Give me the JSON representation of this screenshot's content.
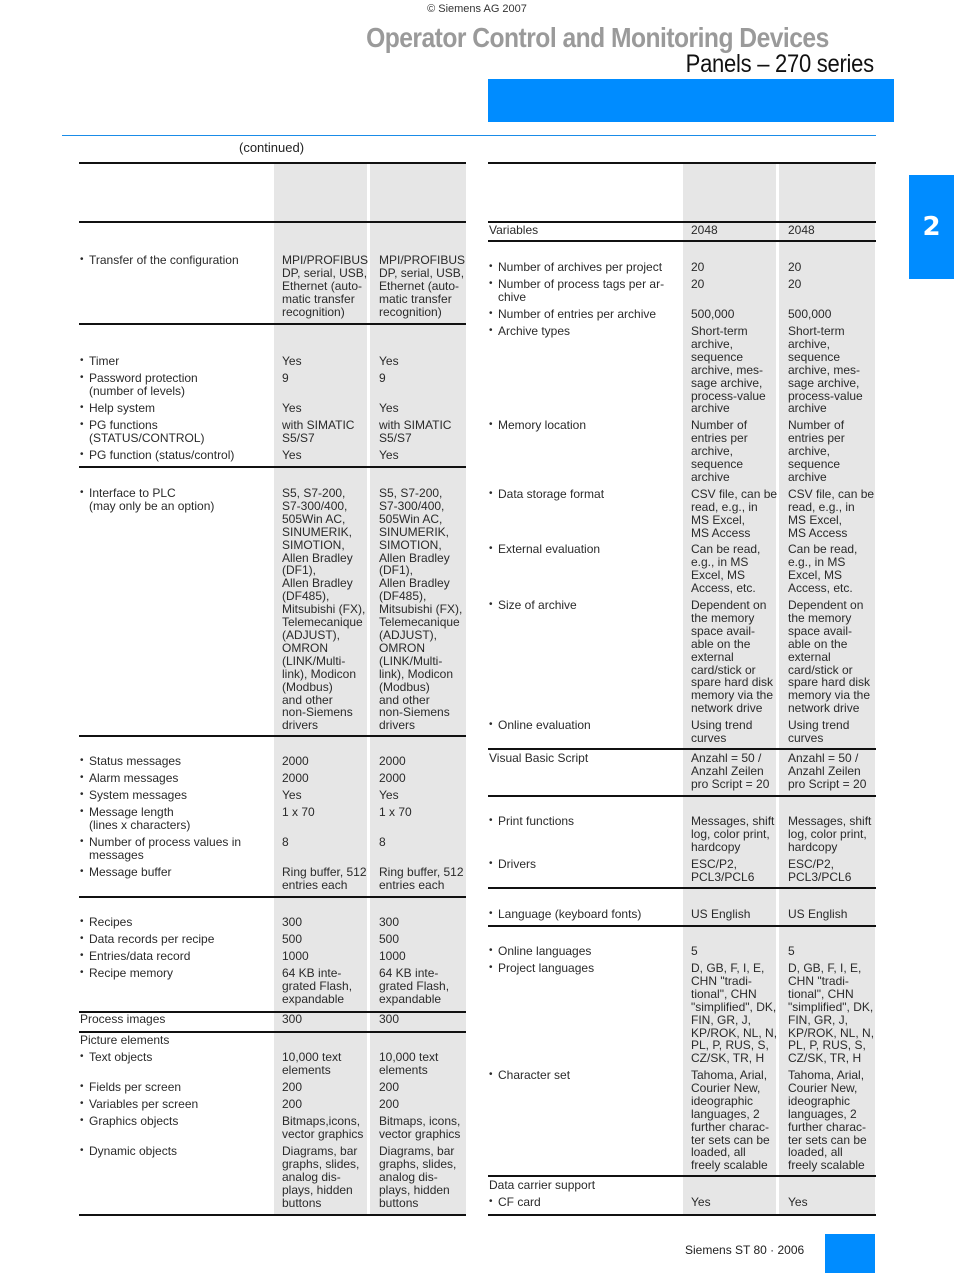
{
  "header": {
    "copyright": "© Siemens AG 2007",
    "title": "Operator Control and Monitoring Devices",
    "subtitle": "Panels – 270 series",
    "continued": "(continued)",
    "chapter_tab": "2",
    "brand_color": "#008cff"
  },
  "footer": {
    "text": "Siemens ST 80 · 2006"
  },
  "left_table": {
    "rows": [
      {
        "label": "Transfer of the configuration",
        "bullet": true,
        "values": [
          "MPI/PROFIBUS\nDP, serial, USB,\nEthernet (auto-\nmatic transfer\nrecognition)",
          "MPI/PROFIBUS\nDP, serial, USB,\nEthernet (auto-\nmatic transfer\nrecognition)"
        ]
      },
      {
        "label": "Timer",
        "bullet": true,
        "values": [
          "Yes",
          "Yes"
        ]
      },
      {
        "label": "Password protection\n(number of levels)",
        "bullet": true,
        "values": [
          "9",
          "9"
        ]
      },
      {
        "label": "Help system",
        "bullet": true,
        "values": [
          "Yes",
          "Yes"
        ]
      },
      {
        "label": "PG functions\n(STATUS/CONTROL)",
        "bullet": true,
        "values": [
          "with SIMATIC\nS5/S7",
          "with SIMATIC\nS5/S7"
        ]
      },
      {
        "label": "PG function (status/control)",
        "bullet": true,
        "values": [
          "Yes",
          "Yes"
        ]
      },
      {
        "label": "Interface to PLC\n(may only be an option)",
        "bullet": true,
        "values": [
          "S5, S7-200,\nS7-300/400,\n505Win AC,\nSINUMERIK,\nSIMOTION,\nAllen Bradley\n(DF1),\nAllen Bradley\n(DF485),\nMitsubishi (FX),\nTelemecanique\n(ADJUST),\nOMRON\n(LINK/Multi-\nlink), Modicon\n(Modbus)\nand other\nnon-Siemens\ndrivers",
          "S5, S7-200,\nS7-300/400,\n505Win AC,\nSINUMERIK,\nSIMOTION,\nAllen Bradley\n(DF1),\nAllen Bradley\n(DF485),\nMitsubishi (FX),\nTelemecanique\n(ADJUST),\nOMRON\n(LINK/Multi-\nlink), Modicon\n(Modbus)\nand other\nnon-Siemens\ndrivers"
        ]
      },
      {
        "label": "Status messages",
        "bullet": true,
        "values": [
          "2000",
          "2000"
        ]
      },
      {
        "label": "Alarm messages",
        "bullet": true,
        "values": [
          "2000",
          "2000"
        ]
      },
      {
        "label": "System messages",
        "bullet": true,
        "values": [
          "Yes",
          "Yes"
        ]
      },
      {
        "label": "Message length\n(lines x characters)",
        "bullet": true,
        "values": [
          "1 x 70",
          "1 x 70"
        ]
      },
      {
        "label": "Number of process values in\nmessages",
        "bullet": true,
        "values": [
          "8",
          "8"
        ]
      },
      {
        "label": "Message buffer",
        "bullet": true,
        "values": [
          "Ring buffer, 512\nentries each",
          "Ring buffer, 512\nentries each"
        ]
      },
      {
        "label": "Recipes",
        "bullet": true,
        "values": [
          "300",
          "300"
        ]
      },
      {
        "label": "Data records per recipe",
        "bullet": true,
        "values": [
          "500",
          "500"
        ]
      },
      {
        "label": "Entries/data record",
        "bullet": true,
        "values": [
          "1000",
          "1000"
        ]
      },
      {
        "label": "Recipe memory",
        "bullet": true,
        "values": [
          "64 KB inte-\ngrated Flash,\nexpandable",
          "64 KB inte-\ngrated Flash,\nexpandable"
        ]
      },
      {
        "label": "Process images",
        "bullet": false,
        "values": [
          "300",
          "300"
        ]
      },
      {
        "label": "Picture elements",
        "bullet": false,
        "values": [
          "",
          ""
        ]
      },
      {
        "label": "Text objects",
        "bullet": true,
        "values": [
          "10,000 text\nelements",
          "10,000 text\nelements"
        ]
      },
      {
        "label": "Fields per screen",
        "bullet": true,
        "values": [
          "200",
          "200"
        ]
      },
      {
        "label": "Variables per screen",
        "bullet": true,
        "values": [
          "200",
          "200"
        ]
      },
      {
        "label": "Graphics objects",
        "bullet": true,
        "values": [
          "Bitmaps,icons,\nvector graphics",
          "Bitmaps, icons,\nvector graphics"
        ]
      },
      {
        "label": "Dynamic objects",
        "bullet": true,
        "values": [
          "Diagrams, bar\ngraphs, slides,\nanalog dis-\nplays, hidden\nbuttons",
          "Diagrams, bar\ngraphs, slides,\nanalog dis-\nplays, hidden\nbuttons"
        ]
      }
    ]
  },
  "right_table": {
    "rows": [
      {
        "label": "Variables",
        "bullet": false,
        "values": [
          "2048",
          "2048"
        ]
      },
      {
        "label": "Number of archives per project",
        "bullet": true,
        "values": [
          "20",
          "20"
        ]
      },
      {
        "label": "Number of process tags per ar-\nchive",
        "bullet": true,
        "values": [
          "20",
          "20"
        ]
      },
      {
        "label": "Number of entries per archive",
        "bullet": true,
        "values": [
          "500,000",
          "500,000"
        ]
      },
      {
        "label": "Archive types",
        "bullet": true,
        "values": [
          "Short-term\narchive,\nsequence\narchive, mes-\nsage archive,\nprocess-value\narchive",
          "Short-term\narchive,\nsequence\narchive, mes-\nsage archive,\nprocess-value\narchive"
        ]
      },
      {
        "label": "Memory location",
        "bullet": true,
        "values": [
          "Number of\nentries per\narchive,\nsequence\narchive",
          "Number of\nentries per\narchive,\nsequence\narchive"
        ]
      },
      {
        "label": "Data storage format",
        "bullet": true,
        "values": [
          "CSV file, can be\nread, e.g., in\nMS Excel,\nMS Access",
          "CSV file, can be\nread, e.g., in\nMS Excel,\nMS Access"
        ]
      },
      {
        "label": "External evaluation",
        "bullet": true,
        "values": [
          "Can be read,\ne.g., in MS\nExcel, MS\nAccess, etc.",
          "Can be read,\ne.g., in MS\nExcel, MS\nAccess, etc."
        ]
      },
      {
        "label": "Size of archive",
        "bullet": true,
        "values": [
          "Dependent on\nthe memory\nspace avail-\nable on the\nexternal\ncard/stick or\nspare hard disk\nmemory via the\nnetwork drive",
          "Dependent on\nthe memory\nspace avail-\nable on the\nexternal\ncard/stick or\nspare hard disk\nmemory via the\nnetwork drive"
        ]
      },
      {
        "label": "Online evaluation",
        "bullet": true,
        "values": [
          "Using trend\ncurves",
          "Using trend\ncurves"
        ]
      },
      {
        "label": "Visual Basic Script",
        "bullet": false,
        "values": [
          "Anzahl = 50 /\nAnzahl Zeilen\npro Script = 20",
          "Anzahl = 50 /\nAnzahl Zeilen\npro Script = 20"
        ]
      },
      {
        "label": "Print functions",
        "bullet": true,
        "values": [
          "Messages, shift\nlog, color print,\nhardcopy",
          "Messages, shift\nlog, color print,\nhardcopy"
        ]
      },
      {
        "label": "Drivers",
        "bullet": true,
        "values": [
          "ESC/P2,\nPCL3/PCL6",
          "ESC/P2,\nPCL3/PCL6"
        ]
      },
      {
        "label": "Language (keyboard fonts)",
        "bullet": true,
        "values": [
          "US English",
          "US English"
        ]
      },
      {
        "label": "Online languages",
        "bullet": true,
        "values": [
          "5",
          "5"
        ]
      },
      {
        "label": "Project languages",
        "bullet": true,
        "values": [
          "D, GB, F, I, E,\nCHN \"tradi-\ntional\", CHN\n\"simplified\", DK,\nFIN, GR, J,\nKP/ROK, NL, N,\nPL, P, RUS, S,\nCZ/SK, TR, H",
          "D, GB, F, I, E,\nCHN \"tradi-\ntional\", CHN\n\"simplified\", DK,\nFIN, GR, J,\nKP/ROK, NL, N,\nPL, P, RUS, S,\nCZ/SK, TR, H"
        ]
      },
      {
        "label": "Character set",
        "bullet": true,
        "values": [
          "Tahoma, Arial,\nCourier New,\nideographic\nlanguages, 2\nfurther charac-\nter sets can be\nloaded, all\nfreely scalable",
          "Tahoma, Arial,\nCourier New,\nideographic\nlanguages, 2\nfurther charac-\nter sets can be\nloaded, all\nfreely scalable"
        ]
      },
      {
        "label": "Data carrier support",
        "bullet": false,
        "values": [
          "",
          ""
        ]
      },
      {
        "label": "CF card",
        "bullet": true,
        "values": [
          "Yes",
          "Yes"
        ]
      }
    ]
  }
}
